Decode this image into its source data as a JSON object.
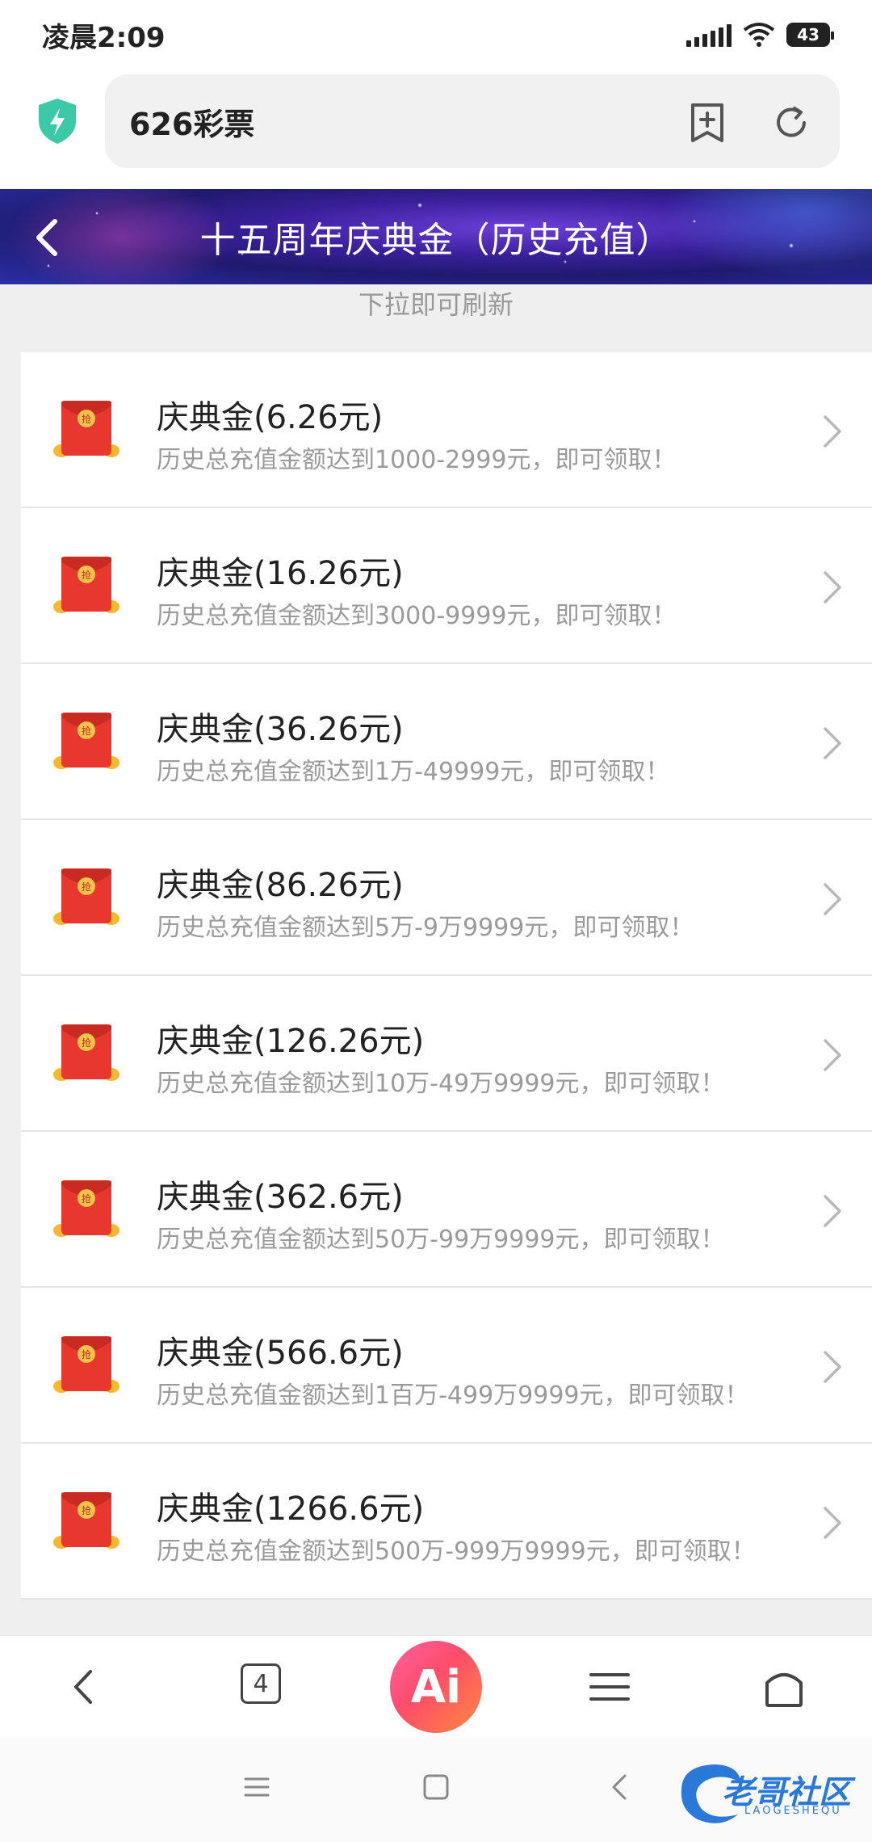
{
  "status_bar": {
    "time": "凌晨2:09",
    "battery": "43"
  },
  "address_bar": {
    "url_text": "626彩票"
  },
  "header": {
    "title": "十五周年庆典金（历史充值）"
  },
  "pull_hint": "下拉即可刷新",
  "items": [
    {
      "title": "庆典金(6.26元)",
      "desc": "历史总充值金额达到1000-2999元，即可领取！"
    },
    {
      "title": "庆典金(16.26元)",
      "desc": "历史总充值金额达到3000-9999元，即可领取！"
    },
    {
      "title": "庆典金(36.26元)",
      "desc": "历史总充值金额达到1万-49999元，即可领取！"
    },
    {
      "title": "庆典金(86.26元)",
      "desc": "历史总充值金额达到5万-9万9999元，即可领取！"
    },
    {
      "title": "庆典金(126.26元)",
      "desc": "历史总充值金额达到10万-49万9999元，即可领取！"
    },
    {
      "title": "庆典金(362.6元)",
      "desc": "历史总充值金额达到50万-99万9999元，即可领取！"
    },
    {
      "title": "庆典金(566.6元)",
      "desc": "历史总充值金额达到1百万-499万9999元，即可领取！"
    },
    {
      "title": "庆典金(1266.6元)",
      "desc": "历史总充值金额达到500万-999万9999元，即可领取！"
    }
  ],
  "packet_badge": "抢",
  "toolbar": {
    "tabs_count": "4",
    "ai_label": "Ai"
  },
  "watermark": {
    "text": "老哥社区",
    "sub": "LAOGESHEQU"
  },
  "colors": {
    "packet_red": "#e8372e",
    "accent_blue": "#2a78d8",
    "shield_teal": "#3cc9a8"
  }
}
